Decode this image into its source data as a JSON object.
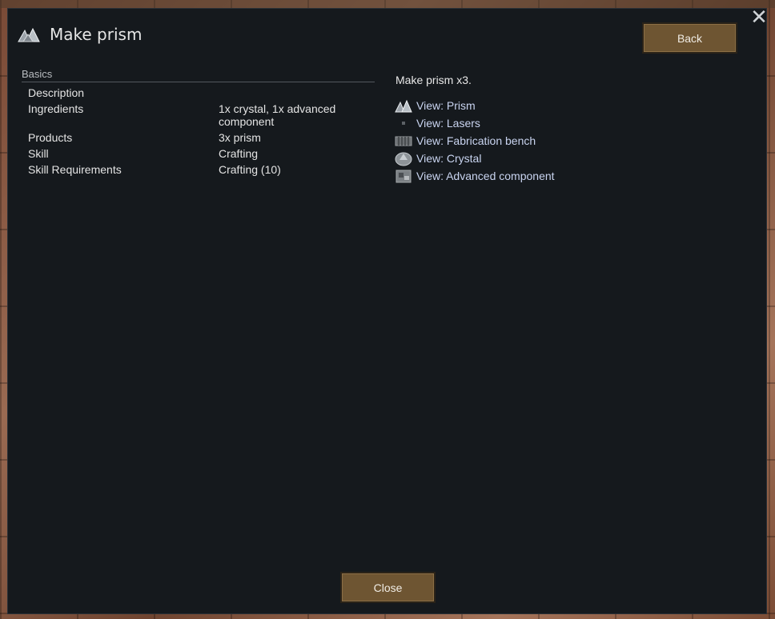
{
  "window": {
    "title": "Make prism",
    "title_icon": "prism-icon",
    "back_label": "Back",
    "close_label": "Close",
    "close_x_icon": "close-icon"
  },
  "basics": {
    "section_label": "Basics",
    "rows": [
      {
        "label": "Description",
        "value": ""
      },
      {
        "label": "Ingredients",
        "value": "1x crystal, 1x advanced component"
      },
      {
        "label": "Products",
        "value": "3x prism"
      },
      {
        "label": "Skill",
        "value": "Crafting"
      },
      {
        "label": "Skill Requirements",
        "value": "Crafting (10)"
      }
    ]
  },
  "details": {
    "description": "Make prism x3.",
    "links": [
      {
        "label": "View: Prism",
        "icon": "prism-icon"
      },
      {
        "label": "View: Lasers",
        "icon": "dot-icon"
      },
      {
        "label": "View: Fabrication bench",
        "icon": "bench-icon"
      },
      {
        "label": "View: Crystal",
        "icon": "crystal-icon"
      },
      {
        "label": "View: Advanced component",
        "icon": "component-icon"
      }
    ]
  },
  "colors": {
    "dialog_bg": "#15191d",
    "button": "#6e5532",
    "link": "#c9d4f0"
  }
}
